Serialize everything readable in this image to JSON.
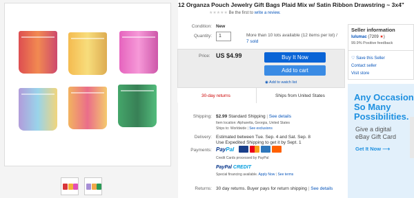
{
  "listing": {
    "title": "12 Organza Pouch Jewelry Gift Bags Plaid Mix w/ Satin Ribbon Drawstring ~ 3x4\"",
    "review_prefix": "Be the first to",
    "review_link": "write a review."
  },
  "condition": {
    "label": "Condition:",
    "value": "New"
  },
  "quantity": {
    "label": "Quantity:",
    "value": "1",
    "note_line1": "More than 10 lots available (12 items per lot) /",
    "note_sold": "7 sold"
  },
  "price": {
    "label": "Price:",
    "value": "US $4.99"
  },
  "actions": {
    "buy_now": "Buy It Now",
    "add_to_cart": "Add to cart",
    "watch": "Add to watch list"
  },
  "returns_badge": "30-day returns",
  "ships_from": "Ships from United States",
  "shipping": {
    "label": "Shipping:",
    "cost": "$2.99",
    "method": "Standard Shipping",
    "details_link": "See details",
    "location": "Item location: Alpharetta, Georgia, United States",
    "ships_to_prefix": "Ships to: Worldwide",
    "exclusions_link": "See exclusions"
  },
  "delivery": {
    "label": "Delivery:",
    "line1": "Estimated between Tue. Sep. 4 and Sat. Sep. 8",
    "line2": "Use Expedited Shipping to get it by Sept. 1"
  },
  "payments": {
    "label": "Payments:",
    "paypal_a": "Pay",
    "paypal_b": "Pal",
    "card_colors": [
      "#1a3f8a",
      "#eb001b",
      "#2e77bb",
      "#ff6000"
    ],
    "credit_note": "Credit Cards processed by PayPal",
    "credit_a": "PayPal ",
    "credit_b": "CREDIT",
    "financing": "Special financing available.",
    "apply_link": "Apply Now",
    "terms_link": "See terms"
  },
  "returns": {
    "label": "Returns:",
    "text": "30 day returns. Buyer pays for return shipping",
    "details_link": "See details"
  },
  "seller": {
    "title": "Seller information",
    "name": "lulumac",
    "score": "(7209",
    "feedback": "99.9% Positive feedback",
    "save": "Save this Seller",
    "contact": "Contact seller",
    "visit": "Visit store"
  },
  "ad": {
    "headline_1": "Any Occasion",
    "headline_2": "So Many",
    "headline_3": "Possibilities.",
    "sub_1": "Give a digital",
    "sub_2": "eBay Gift Card",
    "cta": "Get It Now"
  },
  "bag_colors": [
    "#d9363a",
    "#f3b238",
    "#e24fb5",
    "#a78fd6",
    "#f1a94a",
    "#2b9a56"
  ]
}
